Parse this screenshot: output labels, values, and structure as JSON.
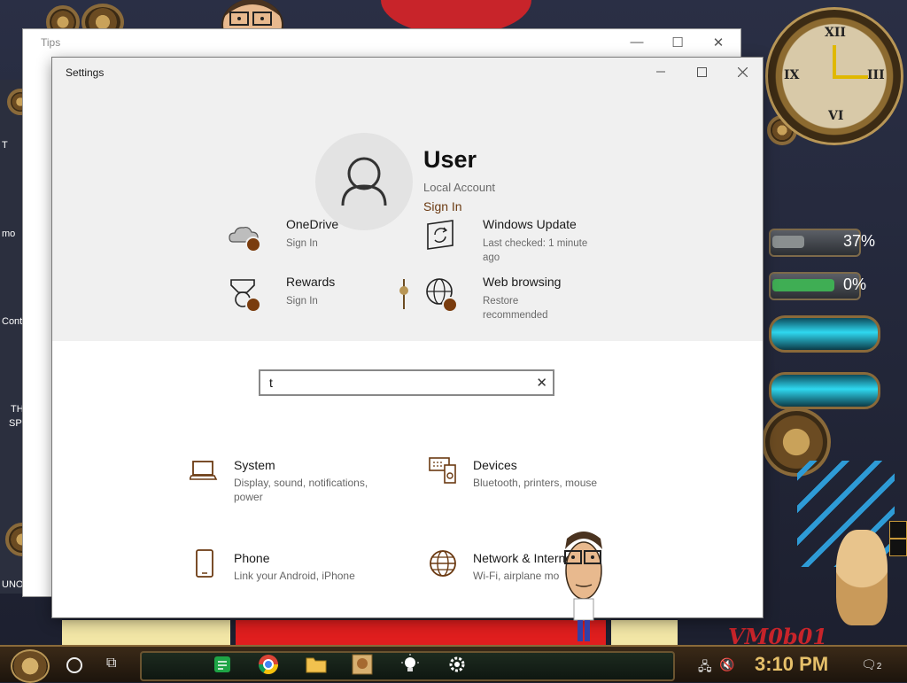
{
  "tips_window": {
    "title": "Tips"
  },
  "settings": {
    "title": "Settings",
    "user": {
      "name": "User",
      "account_type": "Local Account",
      "sign_in": "Sign In"
    },
    "tiles": [
      {
        "title": "OneDrive",
        "subtitle": "Sign In",
        "icon": "cloud-icon"
      },
      {
        "title": "Windows Update",
        "subtitle": "Last checked: 1 minute ago",
        "icon": "sync-icon"
      },
      {
        "title": "Rewards",
        "subtitle": "Sign In",
        "icon": "medal-icon"
      },
      {
        "title": "Web browsing",
        "subtitle": "Restore recommended",
        "icon": "globe-icon"
      }
    ],
    "search": {
      "value": "t"
    },
    "categories": [
      {
        "title": "System",
        "subtitle": "Display, sound, notifications, power",
        "icon": "laptop-icon"
      },
      {
        "title": "Devices",
        "subtitle": "Bluetooth, printers, mouse",
        "icon": "keyboard-speaker-icon"
      },
      {
        "title": "Phone",
        "subtitle": "Link your Android, iPhone",
        "icon": "phone-icon"
      },
      {
        "title": "Network & Interne",
        "subtitle": "Wi-Fi, airplane mo",
        "icon": "globe-icon"
      }
    ]
  },
  "desktop": {
    "meter1": "37%",
    "meter2": "0%",
    "watermark": "VM0b01",
    "left_labels": [
      "T",
      "mo",
      "Cont",
      "TH",
      "SPY",
      "UNO"
    ],
    "clock_numerals": [
      "XII",
      "III",
      "VI",
      "IX"
    ]
  },
  "taskbar": {
    "time": "3:10 PM",
    "notification_count": "2",
    "apps": [
      "chat-app-icon",
      "chrome-icon",
      "file-explorer-icon",
      "photo-app-icon",
      "tips-bulb-icon",
      "settings-gear-icon"
    ]
  },
  "colors": {
    "accent": "#6b3a12",
    "badge": "#7a3c0e",
    "header_bg": "#f0f0f0",
    "taskbar_time": "#e6c06a"
  }
}
